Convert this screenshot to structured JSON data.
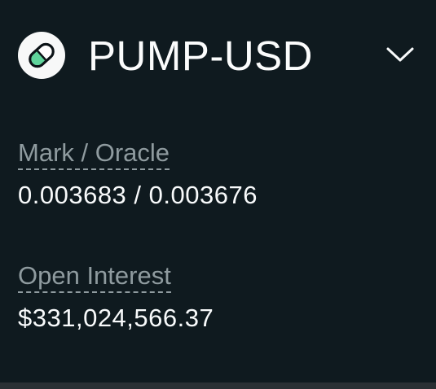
{
  "header": {
    "market_name": "PUMP-USD",
    "logo_icon": "pill-icon",
    "dropdown_icon": "chevron-down-icon"
  },
  "stats": {
    "mark_oracle": {
      "label": "Mark / Oracle",
      "value": "0.003683 / 0.003676"
    },
    "open_interest": {
      "label": "Open Interest",
      "value": "$331,024,566.37"
    }
  },
  "colors": {
    "background": "#0f1a1f",
    "text": "#f8fafb",
    "muted_text": "#8f9b9f",
    "pill_green": "#5fd49b",
    "bottom_bar": "#2a3034"
  }
}
